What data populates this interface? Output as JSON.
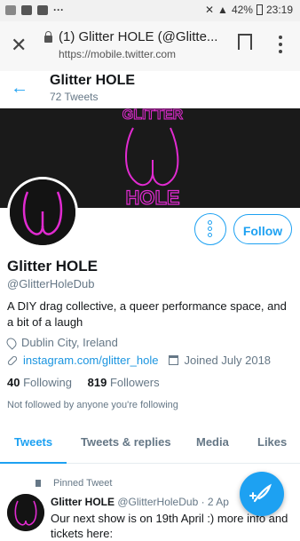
{
  "status_bar": {
    "battery": "42%",
    "time": "23:19",
    "overflow": "···"
  },
  "browser": {
    "tab_title": "(1) Glitter HOLE (@Glitte...",
    "url": "https://mobile.twitter.com",
    "close_icon": "close-icon",
    "lock_icon": "lock-icon",
    "bookmark_icon": "bookmark-icon",
    "menu_icon": "more-vert-icon"
  },
  "header": {
    "back_icon": "arrow-left-icon",
    "name": "Glitter HOLE",
    "tweet_count": "72 Tweets"
  },
  "banner": {
    "top_word": "GLITTER",
    "bottom_word": "HOLE"
  },
  "profile": {
    "display_name": "Glitter HOLE",
    "handle": "@GlitterHoleDub",
    "bio": "A DIY drag collective, a queer performance space, and a bit of a laugh",
    "location": "Dublin City, Ireland",
    "website": "instagram.com/glitter_hole",
    "joined": "Joined July 2018",
    "following_count": "40",
    "following_label": "Following",
    "followers_count": "819",
    "followers_label": "Followers",
    "not_followed": "Not followed by anyone you're following"
  },
  "actions": {
    "follow_label": "Follow",
    "more_icon": "more-options-icon"
  },
  "tabs": [
    {
      "label": "Tweets",
      "active": true
    },
    {
      "label": "Tweets & replies",
      "active": false
    },
    {
      "label": "Media",
      "active": false
    },
    {
      "label": "Likes",
      "active": false
    }
  ],
  "pinned_tweet": {
    "pinned_label": "Pinned Tweet",
    "name": "Glitter HOLE",
    "handle": "@GlitterHoleDub",
    "date": "· 2 Ap",
    "text": "Our next show is on 19th April :) more info and tickets here:"
  },
  "fab_icon": "compose-tweet-icon",
  "colors": {
    "accent": "#1da1f2",
    "neon": "#e12bd1"
  }
}
